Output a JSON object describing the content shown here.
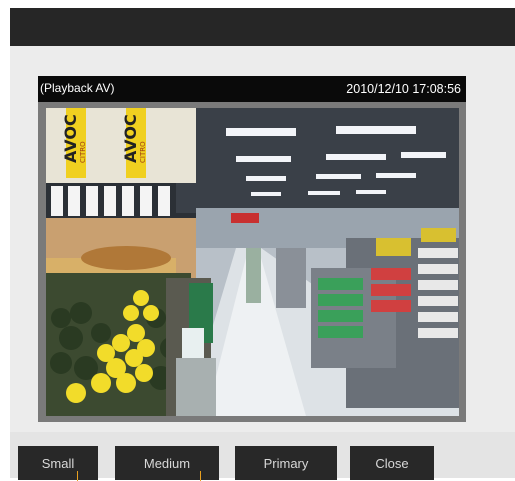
{
  "viewer": {
    "mode_label": "(Playback AV)",
    "timestamp": "2010/12/10  17:08:56"
  },
  "video": {
    "description_icon": "supermarket-camera-frame",
    "signs": [
      "AVOC",
      "AVOC",
      "CITRO",
      "CITRO"
    ]
  },
  "buttons": {
    "small": "Small",
    "medium": "Medium",
    "primary": "Primary",
    "close": "Close"
  },
  "colors": {
    "titlebar": "#262626",
    "button_bg": "#282828",
    "accent_marker": "#e8a020"
  }
}
